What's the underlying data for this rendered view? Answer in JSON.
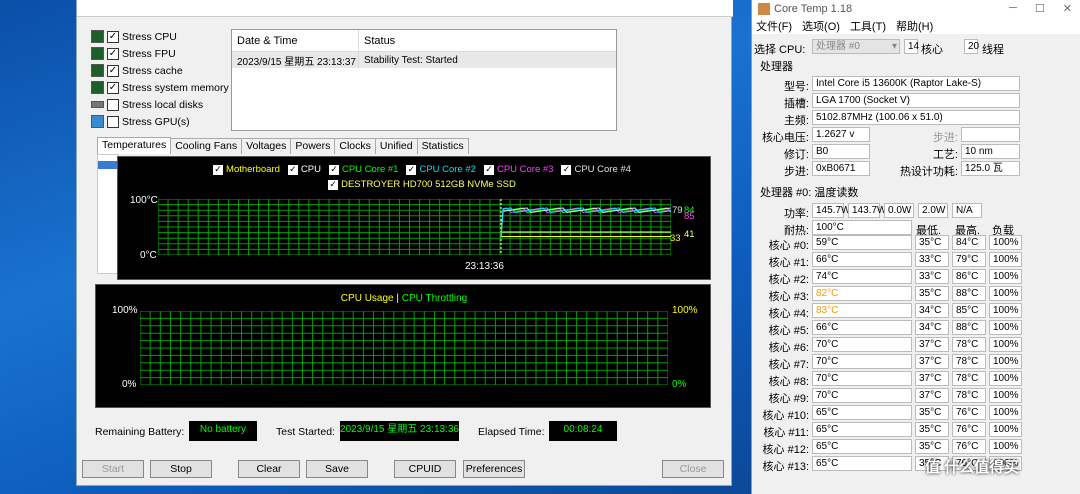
{
  "aida": {
    "stress": [
      {
        "label": "Stress CPU",
        "checked": true
      },
      {
        "label": "Stress FPU",
        "checked": true
      },
      {
        "label": "Stress cache",
        "checked": true
      },
      {
        "label": "Stress system memory",
        "checked": true
      },
      {
        "label": "Stress local disks",
        "checked": false
      },
      {
        "label": "Stress GPU(s)",
        "checked": false
      }
    ],
    "table": {
      "col1": "Date & Time",
      "col2": "Status",
      "row_date": "2023/9/15 星期五 23:13:37",
      "row_status": "Stability Test: Started"
    },
    "tabs": [
      "Temperatures",
      "Cooling Fans",
      "Voltages",
      "Powers",
      "Clocks",
      "Unified",
      "Statistics"
    ],
    "temp_legend": [
      {
        "label": "Motherboard",
        "color": "#ffff00"
      },
      {
        "label": "CPU",
        "color": "#ffffff"
      },
      {
        "label": "CPU Core #1",
        "color": "#00ff00"
      },
      {
        "label": "CPU Core #2",
        "color": "#00e0ff"
      },
      {
        "label": "CPU Core #3",
        "color": "#ff40ff"
      },
      {
        "label": "CPU Core #4",
        "color": "#e0e0e0"
      },
      {
        "label": "DESTROYER HD700 512GB NVMe SSD",
        "color": "#ffff60"
      }
    ],
    "temp_y_top": "100°C",
    "temp_y_bot": "0°C",
    "temp_time": "23:13:36",
    "temp_values": [
      {
        "v": "79",
        "color": "#e0e0e0"
      },
      {
        "v": "84",
        "color": "#00ff00"
      },
      {
        "v": "85",
        "color": "#ff40ff"
      },
      {
        "v": "41",
        "color": "#ffff60"
      },
      {
        "v": "33",
        "color": "#ffff00"
      }
    ],
    "cpu_graph": {
      "title_a": "CPU Usage",
      "sep": "|",
      "title_b": "CPU Throttling",
      "y_top": "100%",
      "y_bot": "0%",
      "y_top_r": "100%",
      "y_bot_r": "0%"
    },
    "bottom": {
      "battery_label": "Remaining Battery:",
      "battery": "No battery",
      "started_label": "Test Started:",
      "started": "2023/9/15 星期五 23:13:36",
      "elapsed_label": "Elapsed Time:",
      "elapsed": "00:08:24"
    },
    "buttons": {
      "start": "Start",
      "stop": "Stop",
      "clear": "Clear",
      "save": "Save",
      "cpuid": "CPUID",
      "prefs": "Preferences",
      "close": "Close"
    }
  },
  "coretemp": {
    "title": "Core Temp 1.18",
    "menu": [
      "文件(F)",
      "选项(O)",
      "工具(T)",
      "帮助(H)"
    ],
    "sel_cpu_label": "选择 CPU:",
    "sel_cpu": "处理器 #0",
    "cores": "14",
    "cores_label": "核心",
    "threads": "20",
    "threads_label": "线程",
    "proc_group": "处理器",
    "model_label": "型号:",
    "model": "Intel Core i5 13600K (Raptor Lake-S)",
    "socket_label": "插槽:",
    "socket": "LGA 1700 (Socket V)",
    "freq_label": "主频:",
    "freq": "5102.87MHz (100.06 x 51.0)",
    "vid_label": "核心电压:",
    "vid": "1.2627 v",
    "step_label": "步进:",
    "step": "",
    "rev_label": "修订:",
    "rev": "B0",
    "lith_label": "工艺:",
    "lith": "10 nm",
    "cpuid_label": "步进:",
    "cpuid": "0xB0671",
    "tdp_label": "热设计功耗:",
    "tdp": "125.0 瓦",
    "temp_group": "处理器 #0: 温度读数",
    "power_label": "功率:",
    "powers": [
      "145.7W",
      "143.7W",
      "0.0W",
      "2.0W",
      "N/A"
    ],
    "tj_label": "耐热:",
    "tj": "100°C",
    "min_label": "最低.",
    "max_label": "最高.",
    "load_label": "负载",
    "cores_list": [
      {
        "n": "核心 #0:",
        "t": "59°C",
        "min": "35°C",
        "max": "84°C",
        "load": "100%",
        "hot": false
      },
      {
        "n": "核心 #1:",
        "t": "66°C",
        "min": "33°C",
        "max": "79°C",
        "load": "100%",
        "hot": false
      },
      {
        "n": "核心 #2:",
        "t": "74°C",
        "min": "33°C",
        "max": "86°C",
        "load": "100%",
        "hot": false
      },
      {
        "n": "核心 #3:",
        "t": "82°C",
        "min": "35°C",
        "max": "88°C",
        "load": "100%",
        "hot": true
      },
      {
        "n": "核心 #4:",
        "t": "83°C",
        "min": "34°C",
        "max": "85°C",
        "load": "100%",
        "hot": true
      },
      {
        "n": "核心 #5:",
        "t": "66°C",
        "min": "34°C",
        "max": "88°C",
        "load": "100%",
        "hot": false
      },
      {
        "n": "核心 #6:",
        "t": "70°C",
        "min": "37°C",
        "max": "78°C",
        "load": "100%",
        "hot": false
      },
      {
        "n": "核心 #7:",
        "t": "70°C",
        "min": "37°C",
        "max": "78°C",
        "load": "100%",
        "hot": false
      },
      {
        "n": "核心 #8:",
        "t": "70°C",
        "min": "37°C",
        "max": "78°C",
        "load": "100%",
        "hot": false
      },
      {
        "n": "核心 #9:",
        "t": "70°C",
        "min": "37°C",
        "max": "78°C",
        "load": "100%",
        "hot": false
      },
      {
        "n": "核心 #10:",
        "t": "65°C",
        "min": "35°C",
        "max": "76°C",
        "load": "100%",
        "hot": false
      },
      {
        "n": "核心 #11:",
        "t": "65°C",
        "min": "35°C",
        "max": "76°C",
        "load": "100%",
        "hot": false
      },
      {
        "n": "核心 #12:",
        "t": "65°C",
        "min": "35°C",
        "max": "76°C",
        "load": "100%",
        "hot": false
      },
      {
        "n": "核心 #13:",
        "t": "65°C",
        "min": "35°C",
        "max": "76°C",
        "load": "100%",
        "hot": false
      }
    ],
    "hot_color": "#ff9900"
  },
  "watermark": "值 什么值得买"
}
